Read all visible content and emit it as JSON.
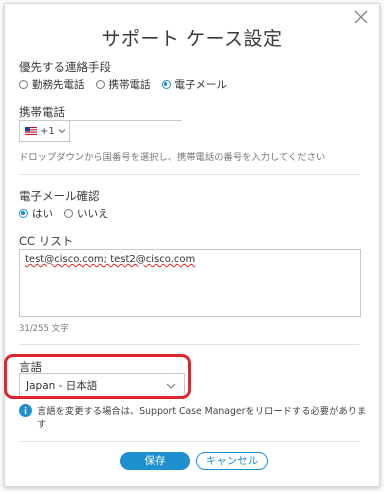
{
  "dialog": {
    "title": "サポート ケース設定"
  },
  "contact_method": {
    "label": "優先する連絡手段",
    "options": [
      {
        "label": "勤務先電話",
        "selected": false
      },
      {
        "label": "携帯電話",
        "selected": false
      },
      {
        "label": "電子メール",
        "selected": true
      }
    ]
  },
  "mobile": {
    "label": "携帯電話",
    "country_code": "+1",
    "value": "",
    "hint": "ドロップダウンから国番号を選択し、携帯電話の番号を入力してください"
  },
  "email_confirm": {
    "label": "電子メール確認",
    "options": [
      {
        "label": "はい",
        "selected": true
      },
      {
        "label": "いいえ",
        "selected": false
      }
    ]
  },
  "cc": {
    "label": "CC リスト",
    "value": "test@cisco.com; test2@cisco.com",
    "counter": "31/255 文字"
  },
  "language": {
    "label": "言語",
    "selected": "Japan - 日本語",
    "info": "言語を変更する場合は、Support Case Managerをリロードする必要があります"
  },
  "buttons": {
    "save": "保存",
    "cancel": "キャンセル"
  },
  "colors": {
    "accent": "#1e8fcf",
    "highlight": "#e0262a"
  }
}
